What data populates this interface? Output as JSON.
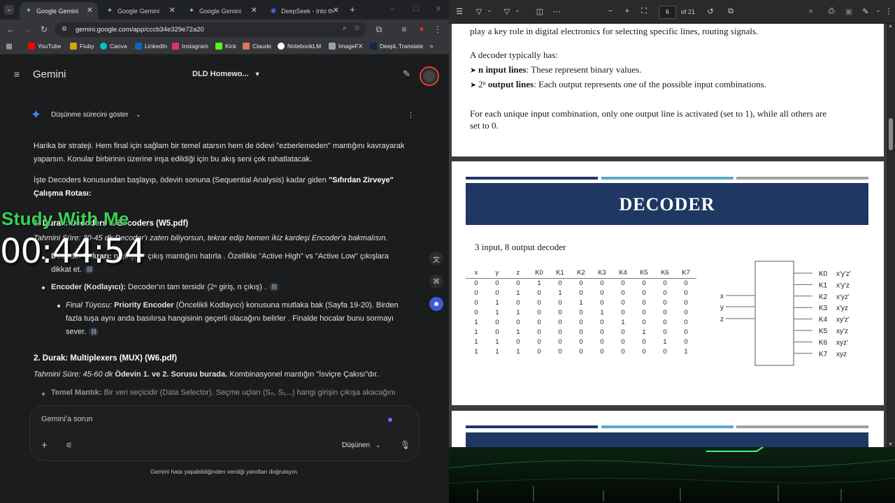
{
  "browser": {
    "tabs": [
      {
        "title": "Google Gemini",
        "active": true
      },
      {
        "title": "Google Gemini",
        "active": false
      },
      {
        "title": "Google Gemini",
        "active": false
      },
      {
        "title": "DeepSeek - Into th",
        "active": false
      }
    ],
    "url": "gemini.google.com/app/cccb34e329e72a20",
    "bookmarks": [
      "YouTube",
      "Fiuby",
      "Canva",
      "LinkedIn",
      "Instagram",
      "Kick",
      "Claude",
      "NotebookLM",
      "ImageFX",
      "DeepL Translate"
    ]
  },
  "gemini": {
    "app_name": "Gemini",
    "chat_title": "DLD Homewo...",
    "thinking_label": "Düşünme sürecini göster",
    "para1": "Harika bir strateji. Hem final için sağlam bir temel atarsın hem de ödevi \"ezberlemeden\" mantığını kavrayarak yaparsın. Konular birbirinin üzerine inşa edildiği için bu akış seni çok rahatlatacak.",
    "para2_a": "İşte Decoders konusundan başlayıp, ödevin sonuna (Sequential Analysis) kadar giden ",
    "para2_b": "\"Sıfırdan Zirveye\" Çalışma Rotası",
    "para2_c": ":",
    "stop1_heading": "1. Durak: Decoders & Encoders (W5.pdf)",
    "stop1_time": "Tahmini Süre: 30-45 dk Decoder'ı zaten biliyorsun, tekrar edip hemen ikiz kardeşi Encoder'a bakmalısın.",
    "stop1_b1_a": "Decoder Tekrarı: ",
    "stop1_b1_b": "n giriş, 2ⁿ çıkış mantığını hatırla . Özellikle \"Active High\" vs \"Active Low\" çıkışlara dikkat et.",
    "stop1_b2_a": "Encoder (Kodlayıcı): ",
    "stop1_b2_b": "Decoder'ın tam tersidir (2ⁿ giriş, n çıkış) .",
    "stop1_b3_a": "Final Tüyosu: ",
    "stop1_b3_b": "Priority Encoder",
    "stop1_b3_c": " (Öncelikli Kodlayıcı) konusuna mutlaka bak (Sayfa 19-20). Birden fazla tuşa aynı anda basılırsa hangisinin geçerli olacağını belirler . Finalde hocalar bunu sormayı sever.",
    "stop2_heading": "2. Durak: Multiplexers (MUX) (W6.pdf)",
    "stop2_time_a": "Tahmini Süre: 45-60 dk ",
    "stop2_time_b": "Ödevin 1. ve 2. Sorusu burada.",
    "stop2_time_c": " Kombinasyonel mantığın \"İsviçre Çakısı\"dır.",
    "stop2_b1_a": "Temel Mantık: ",
    "stop2_b1_b": "Bir veri seçicidir (Data Selector). Seçme uçları (S₀, S₁...) hangi girişin çıkışa akacağını",
    "input_placeholder": "Gemini'a sorun",
    "mode_label": "Düşünen",
    "footer_note": "Gemini hata yapabildiğinden verdiği yanıtları doğrulayın."
  },
  "overlay": {
    "title": "Study With Me",
    "timer": "00:44:54"
  },
  "pdf": {
    "page_current": "6",
    "page_total": "of 21",
    "p1_line0": "play a key role in digital electronics for selecting specific lines, routing signals.",
    "p1_line1": "A decoder typically has:",
    "p1_b1_a": "n input lines",
    "p1_b1_b": ": These represent binary values.",
    "p1_b2_pre": "2ⁿ ",
    "p1_b2_a": "output lines",
    "p1_b2_b": ": Each output represents one of the possible input combinations.",
    "p1_line4": "For each unique input combination, only one output line is activated (set to 1), while all others are",
    "p1_line5": "set to 0.",
    "banner": "DECODER",
    "subtitle": "3 input, 8 output decoder",
    "truth_headers": [
      "x",
      "y",
      "z",
      "K0",
      "K1",
      "K2",
      "K3",
      "K4",
      "K5",
      "K6",
      "K7"
    ],
    "truth_rows": [
      [
        "0",
        "0",
        "0",
        "1",
        "0",
        "0",
        "0",
        "0",
        "0",
        "0",
        "0"
      ],
      [
        "0",
        "0",
        "1",
        "0",
        "1",
        "0",
        "0",
        "0",
        "0",
        "0",
        "0"
      ],
      [
        "0",
        "1",
        "0",
        "0",
        "0",
        "1",
        "0",
        "0",
        "0",
        "0",
        "0"
      ],
      [
        "0",
        "1",
        "1",
        "0",
        "0",
        "0",
        "1",
        "0",
        "0",
        "0",
        "0"
      ],
      [
        "1",
        "0",
        "0",
        "0",
        "0",
        "0",
        "0",
        "1",
        "0",
        "0",
        "0"
      ],
      [
        "1",
        "0",
        "1",
        "0",
        "0",
        "0",
        "0",
        "0",
        "1",
        "0",
        "0"
      ],
      [
        "1",
        "1",
        "0",
        "0",
        "0",
        "0",
        "0",
        "0",
        "0",
        "1",
        "0"
      ],
      [
        "1",
        "1",
        "1",
        "0",
        "0",
        "0",
        "0",
        "0",
        "0",
        "0",
        "1"
      ]
    ],
    "inputs": [
      "x",
      "y",
      "z"
    ],
    "outputs": [
      "K0",
      "K1",
      "K2",
      "K3",
      "K4",
      "K5",
      "K6",
      "K7"
    ],
    "minterms": [
      "x'y'z'",
      "x'y'z",
      "x'yz'",
      "x'yz",
      "xy'z'",
      "xy'z",
      "xyz'",
      "xyz"
    ],
    "bar_colors": [
      "#1f3763",
      "#5fa8c8",
      "#a0a0a0"
    ]
  }
}
